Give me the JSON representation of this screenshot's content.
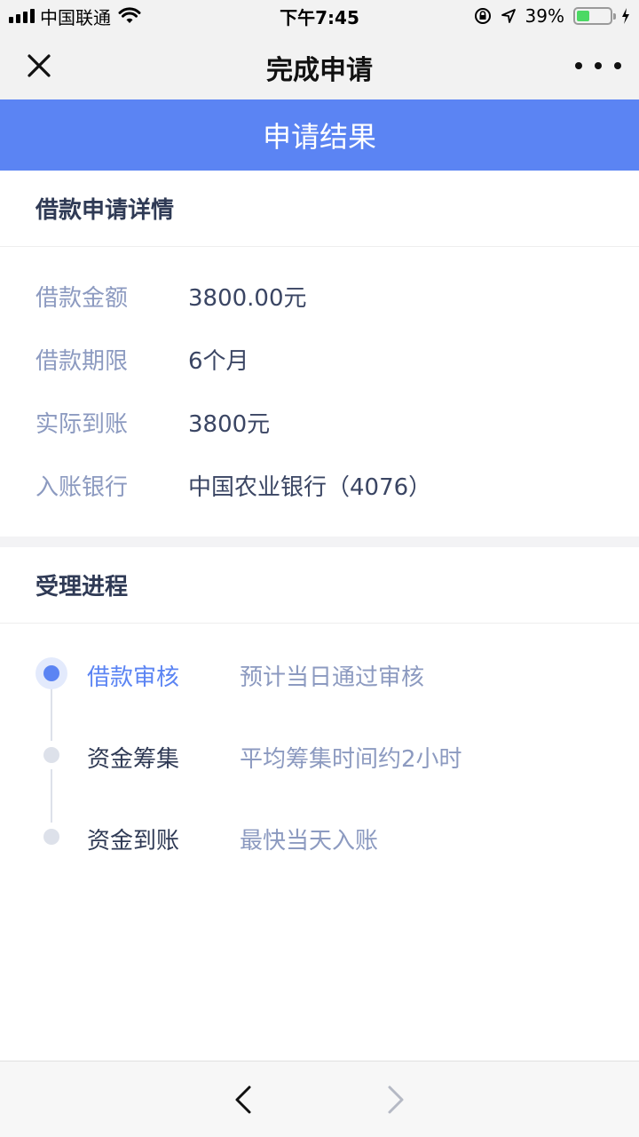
{
  "status_bar": {
    "carrier": "中国联通",
    "time": "下午7:45",
    "battery_percent": "39%",
    "battery_level": 0.39,
    "icons": [
      "signal-icon",
      "wifi-icon",
      "rotation-lock-icon",
      "location-arrow-icon",
      "battery-icon",
      "charging-bolt-icon"
    ]
  },
  "nav": {
    "title": "完成申请",
    "close_icon": "close-icon",
    "more_icon": "more-icon"
  },
  "banner": {
    "text": "申请结果"
  },
  "details": {
    "title": "借款申请详情",
    "rows": [
      {
        "label": "借款金额",
        "value": "3800.00元"
      },
      {
        "label": "借款期限",
        "value": "6个月"
      },
      {
        "label": "实际到账",
        "value": "3800元"
      },
      {
        "label": "入账银行",
        "value": "中国农业银行（4076）"
      }
    ]
  },
  "progress": {
    "title": "受理进程",
    "steps": [
      {
        "name": "借款审核",
        "desc": "预计当日通过审核",
        "active": true
      },
      {
        "name": "资金筹集",
        "desc": "平均筹集时间约2小时",
        "active": false
      },
      {
        "name": "资金到账",
        "desc": "最快当天入账",
        "active": false
      }
    ]
  },
  "toolbar": {
    "back_icon": "chevron-left-icon",
    "forward_icon": "chevron-right-icon"
  },
  "colors": {
    "accent": "#5b84f3",
    "label": "#8c9ac0",
    "text": "#2f3a55",
    "battery": "#4cd964"
  }
}
